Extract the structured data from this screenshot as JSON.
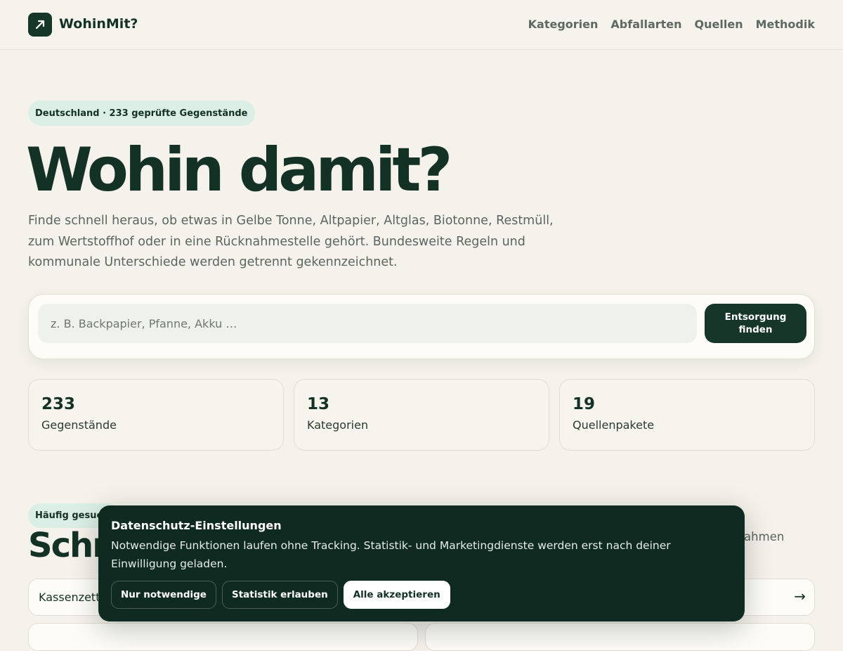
{
  "header": {
    "brand": "WohinMit?",
    "logo_icon": "arrow-up-right-icon",
    "nav": [
      "Kategorien",
      "Abfallarten",
      "Quellen",
      "Methodik"
    ]
  },
  "hero": {
    "badge": "Deutschland · 233 geprüfte Gegenstände",
    "title": "Wohin damit?",
    "text": "Finde schnell heraus, ob etwas in Gelbe Tonne, Altpapier, Altglas, Biotonne, Restmüll, zum Wertstoffhof oder in eine Rücknahmestelle gehört. Bundesweite Regeln und kommunale Unterschiede werden getrennt gekennzeichnet."
  },
  "search": {
    "placeholder": "z. B. Backpapier, Pfanne, Akku …",
    "value": "",
    "button_label": "Entsorgung finden"
  },
  "stats": [
    {
      "value": "233",
      "label": "Gegenstände"
    },
    {
      "value": "13",
      "label": "Kategorien"
    },
    {
      "value": "19",
      "label": "Quellenpakete"
    }
  ],
  "popular": {
    "badge": "Häufig gesucht",
    "title": "Schn",
    "note": "snahmen",
    "first_item": "Kassenzettel",
    "arrow_icon": "arrow-right-icon"
  },
  "cookie": {
    "title": "Datenschutz-Einstellungen",
    "text": "Notwendige Funktionen laufen ohne Tracking. Statistik- und Marketingdienste werden erst nach deiner Einwilligung geladen.",
    "buttons": {
      "necessary": "Nur notwendige",
      "stats": "Statistik erlauben",
      "all": "Alle akzeptieren"
    }
  },
  "colors": {
    "background": "#f4f2ea",
    "primary": "#16362a",
    "badge_bg": "#dcefe6",
    "banner_bg": "#0f2a21"
  }
}
